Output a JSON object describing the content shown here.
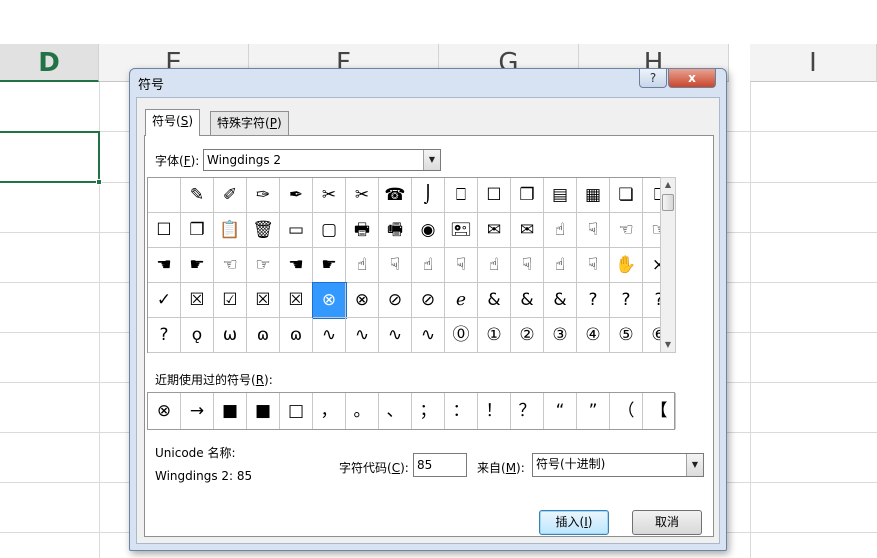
{
  "spreadsheet": {
    "columns": [
      {
        "label": "D",
        "selected": true
      },
      {
        "label": "E",
        "selected": false
      },
      {
        "label": "F",
        "selected": false
      },
      {
        "label": "G",
        "selected": false
      },
      {
        "label": "H",
        "selected": false
      },
      {
        "label": "I",
        "selected": false
      }
    ]
  },
  "dialog": {
    "title": "符号",
    "help_label": "?",
    "close_label": "x",
    "tabs": [
      {
        "label": "符号(",
        "key": "S",
        "suffix": ")",
        "active": true
      },
      {
        "label": "特殊字符(",
        "key": "P",
        "suffix": ")",
        "active": false
      }
    ],
    "font": {
      "label": "字体(",
      "key": "F",
      "suffix": "):",
      "value": "Wingdings 2"
    },
    "symbols": [
      [
        "",
        "✎",
        "✐",
        "✑",
        "✒",
        "✂",
        "✂",
        "☎",
        "⌡",
        "⎕",
        "☐",
        "❐",
        "▤",
        "▦",
        "❏",
        "⎕"
      ],
      [
        "☐",
        "❐",
        "📋",
        "🗑",
        "▭",
        "▢",
        "🖶",
        "🖷",
        "◉",
        "🖭",
        "✉",
        "✉",
        "☝",
        "☟",
        "☜",
        "☞"
      ],
      [
        "☚",
        "☛",
        "☜",
        "☞",
        "☚",
        "☛",
        "☝",
        "☟",
        "☝",
        "☟",
        "☝",
        "☟",
        "☝",
        "☟",
        "✋",
        "×"
      ],
      [
        "✓",
        "☒",
        "☑",
        "☒",
        "☒",
        "⊗",
        "⊗",
        "⊘",
        "⊘",
        "ℯ",
        "&",
        "&",
        "&",
        "?",
        "?",
        "?"
      ],
      [
        "?",
        "ǫ",
        "ω",
        "ɷ",
        "ɷ",
        "∿",
        "∿",
        "∿",
        "∿",
        "⓪",
        "①",
        "②",
        "③",
        "④",
        "⑤",
        "⑥"
      ]
    ],
    "selected_symbol": {
      "row": 3,
      "col": 5
    },
    "recent": {
      "label": "近期使用过的符号(",
      "key": "R",
      "suffix": "):",
      "items": [
        "⊗",
        "→",
        "■",
        "■",
        "□",
        "，",
        "。",
        "、",
        "；",
        "：",
        "！",
        "？",
        "“",
        "”",
        "（",
        "【"
      ]
    },
    "unicode_name_label": "Unicode 名称:",
    "unicode_name_value": "Wingdings 2: 85",
    "char_code": {
      "label": "字符代码(",
      "key": "C",
      "suffix": "):",
      "value": "85"
    },
    "from": {
      "label": "来自(",
      "key": "M",
      "suffix": "):",
      "value": "符号(十进制)"
    },
    "insert_button": {
      "label": "插入(",
      "key": "I",
      "suffix": ")"
    },
    "cancel_button": {
      "label": "取消"
    }
  }
}
